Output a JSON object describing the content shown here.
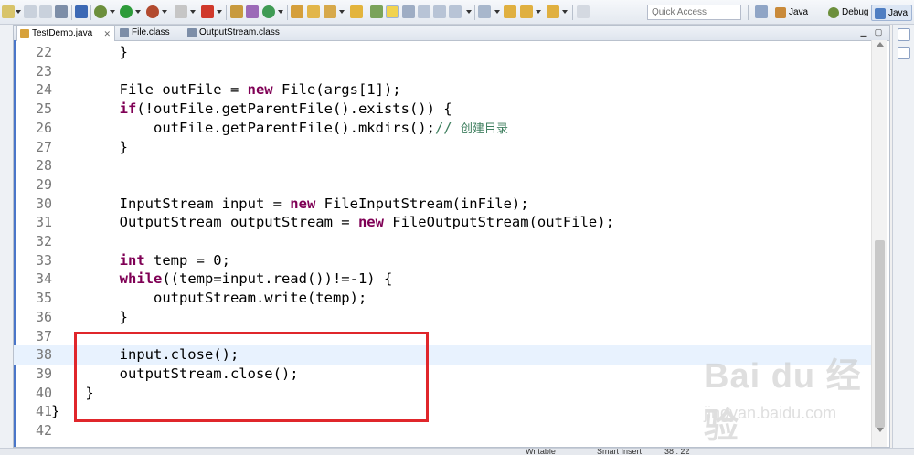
{
  "toolbar": {
    "quick_access_placeholder": "Quick Access",
    "perspectives": [
      {
        "label": "Java EE",
        "active": false
      },
      {
        "label": "Debug",
        "active": false
      },
      {
        "label": "Java",
        "active": true
      }
    ]
  },
  "editor": {
    "tabs": [
      {
        "label": "TestDemo.java",
        "active": true,
        "icon": "java-file-icon"
      },
      {
        "label": "File.class",
        "active": false,
        "icon": "class-file-icon"
      },
      {
        "label": "OutputStream.class",
        "active": false,
        "icon": "class-file-icon"
      }
    ],
    "current_line": 38,
    "lines": [
      {
        "n": "22",
        "code": "        }"
      },
      {
        "n": "23",
        "code": ""
      },
      {
        "n": "24",
        "code": "        File outFile = new File(args[1]);"
      },
      {
        "n": "25",
        "code": "        if(!outFile.getParentFile().exists()) {"
      },
      {
        "n": "26",
        "code": "            outFile.getParentFile().mkdirs();// 创建目录"
      },
      {
        "n": "27",
        "code": "        }"
      },
      {
        "n": "28",
        "code": ""
      },
      {
        "n": "29",
        "code": ""
      },
      {
        "n": "30",
        "code": "        InputStream input = new FileInputStream(inFile);"
      },
      {
        "n": "31",
        "code": "        OutputStream outputStream = new FileOutputStream(outFile);"
      },
      {
        "n": "32",
        "code": ""
      },
      {
        "n": "33",
        "code": "        int temp = 0;"
      },
      {
        "n": "34",
        "code": "        while((temp=input.read())!=-1) {"
      },
      {
        "n": "35",
        "code": "            outputStream.write(temp);"
      },
      {
        "n": "36",
        "code": "        }"
      },
      {
        "n": "37",
        "code": ""
      },
      {
        "n": "38",
        "code": "        input.close();"
      },
      {
        "n": "39",
        "code": "        outputStream.close();"
      },
      {
        "n": "40",
        "code": "    }"
      },
      {
        "n": "41",
        "code": "}"
      },
      {
        "n": "42",
        "code": ""
      }
    ]
  },
  "status_bar": {
    "writable": "Writable",
    "insert_mode": "Smart Insert",
    "position": "38 : 22"
  },
  "watermark": {
    "logo": "Bai du 经验",
    "url": "jingyan.baidu.com"
  },
  "colors": {
    "highlight_box": "#e0262b",
    "keyword": "#7f0055",
    "comment": "#3f7f5f",
    "current_line": "#e8f2fe"
  }
}
